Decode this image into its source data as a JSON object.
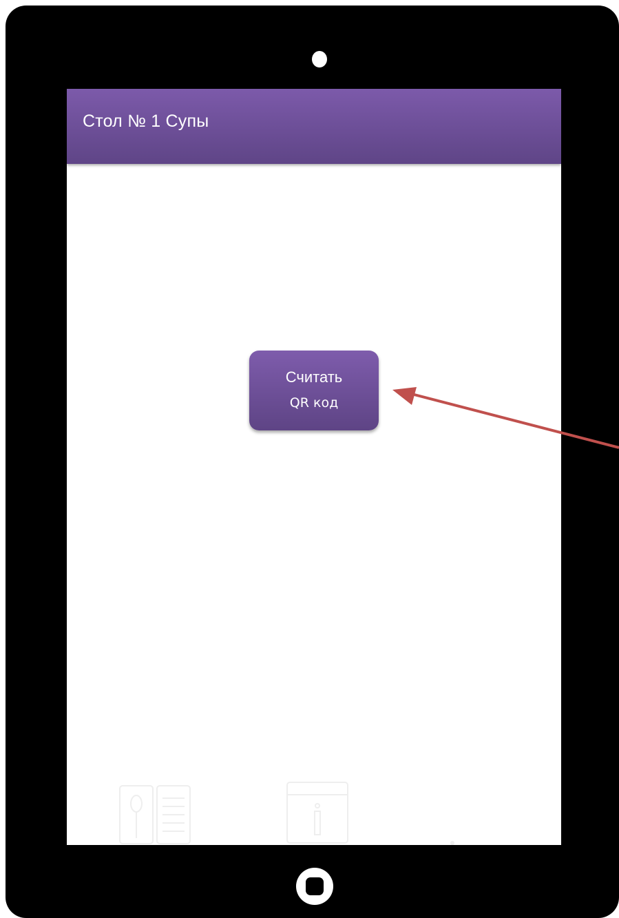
{
  "appbar": {
    "title": "Стол № 1 Супы"
  },
  "main": {
    "qr_button": {
      "line1": "Считать",
      "line2": "QR код"
    }
  },
  "bottom_tabs": {
    "items": [
      {
        "icon": "menu-book-icon"
      },
      {
        "icon": "info-icon"
      },
      {
        "icon": "unknown-tab-icon"
      }
    ]
  },
  "annotation": {
    "arrow_color": "#c0504d"
  },
  "colors": {
    "accent_top": "#7c5aaa",
    "accent_bottom": "#5f4587",
    "device_frame": "#000000"
  }
}
